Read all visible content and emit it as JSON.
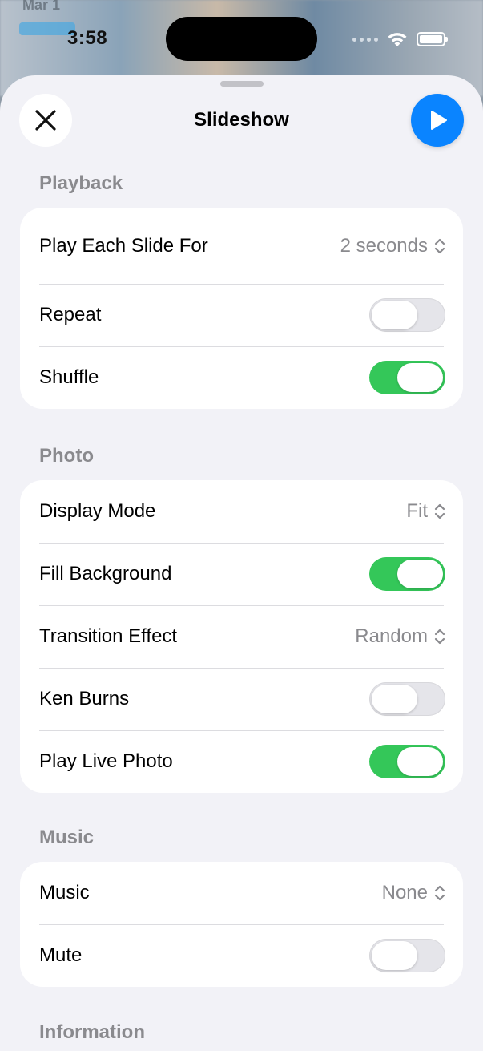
{
  "status_bar": {
    "time": "3:58"
  },
  "background": {
    "date": "Mar 1"
  },
  "header": {
    "title": "Slideshow"
  },
  "sections": {
    "playback": {
      "title": "Playback",
      "play_each_slide_for": {
        "label": "Play Each Slide For",
        "value": "2 seconds"
      },
      "repeat": {
        "label": "Repeat",
        "on": false
      },
      "shuffle": {
        "label": "Shuffle",
        "on": true
      }
    },
    "photo": {
      "title": "Photo",
      "display_mode": {
        "label": "Display Mode",
        "value": "Fit"
      },
      "fill_background": {
        "label": "Fill Background",
        "on": true
      },
      "transition_effect": {
        "label": "Transition Effect",
        "value": "Random"
      },
      "ken_burns": {
        "label": "Ken Burns",
        "on": false
      },
      "play_live_photo": {
        "label": "Play Live Photo",
        "on": true
      }
    },
    "music": {
      "title": "Music",
      "music": {
        "label": "Music",
        "value": "None"
      },
      "mute": {
        "label": "Mute",
        "on": false
      }
    },
    "information": {
      "title": "Information"
    }
  },
  "colors": {
    "accent": "#0a84ff",
    "toggle_on": "#34c759",
    "toggle_off": "#e5e5ea",
    "secondary_text": "#8a8a8e",
    "sheet_background": "#f2f2f7"
  },
  "icons": {
    "close": "close-icon",
    "play": "play-icon",
    "select": "chevron-updown-icon",
    "wifi": "wifi-icon",
    "battery": "battery-icon"
  }
}
